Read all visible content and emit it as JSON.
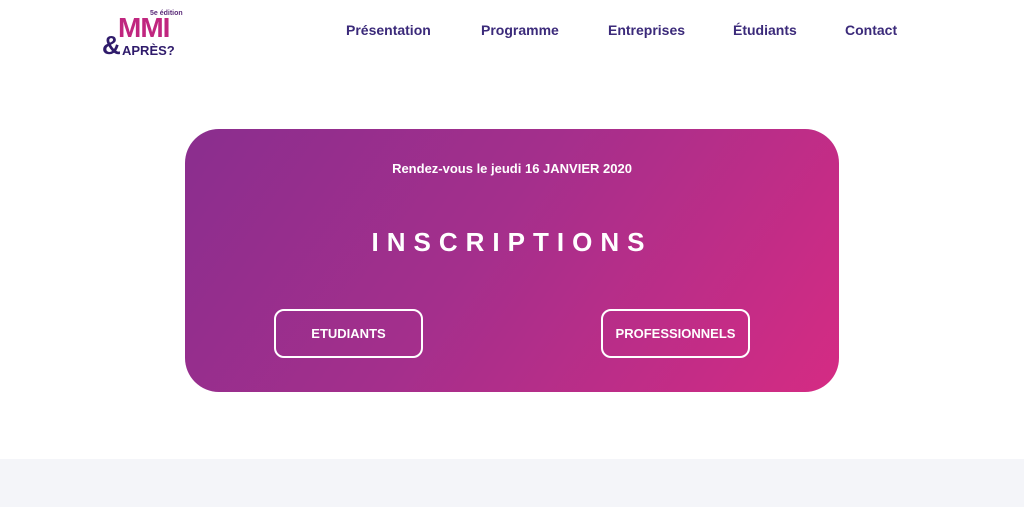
{
  "logo": {
    "edition": "5e édition",
    "mmi": "MMI",
    "amp": "&",
    "apres": "APRÈS?"
  },
  "nav": {
    "items": [
      {
        "label": "Présentation"
      },
      {
        "label": "Programme"
      },
      {
        "label": "Entreprises"
      },
      {
        "label": "Étudiants"
      },
      {
        "label": "Contact"
      }
    ]
  },
  "hero": {
    "date": "Rendez-vous le jeudi 16 JANVIER 2020",
    "title": "INSCRIPTIONS",
    "buttons": {
      "students": "ETUDIANTS",
      "professionals": "PROFESSIONNELS"
    }
  },
  "colors": {
    "nav_text": "#3b2a7a",
    "gradient_start": "#8a2e8e",
    "gradient_end": "#d52b83",
    "footer_band": "#f4f5f9"
  }
}
